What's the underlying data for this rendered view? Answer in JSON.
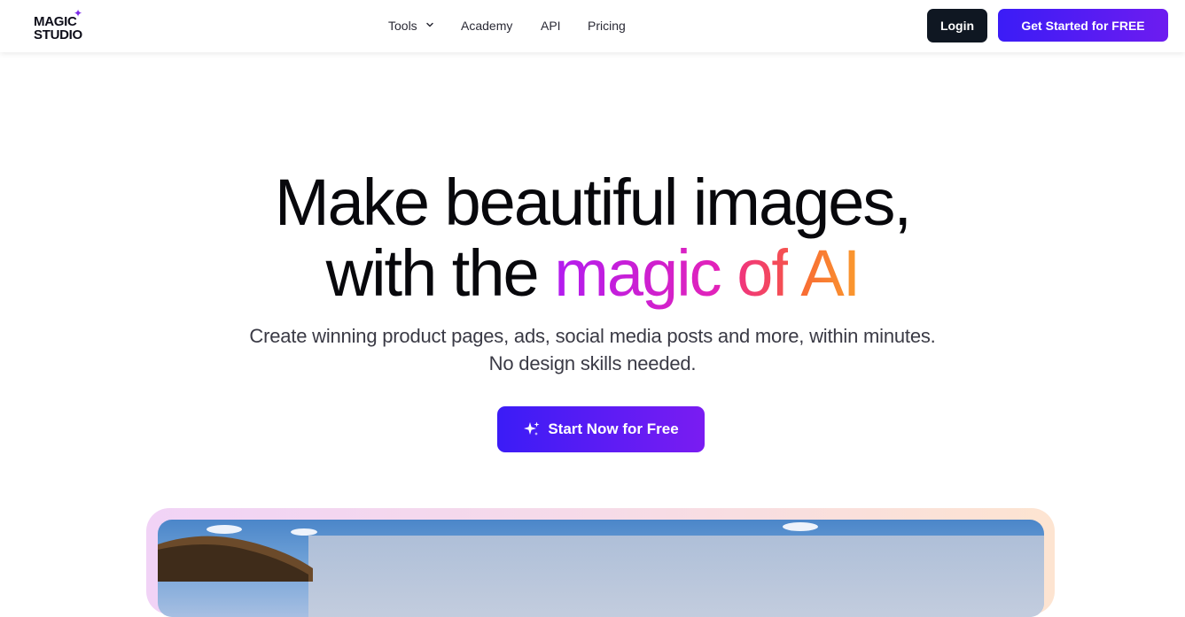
{
  "header": {
    "logo_line1": "MAGIC",
    "logo_line2": "STUDIO",
    "nav": [
      {
        "label": "Tools",
        "has_dropdown": true,
        "icon": "chevron-down-icon"
      },
      {
        "label": "Academy"
      },
      {
        "label": "API"
      },
      {
        "label": "Pricing"
      }
    ],
    "login_label": "Login",
    "get_started_label": "Get Started for FREE"
  },
  "hero": {
    "title_line1": "Make beautiful images,",
    "title_line2_prefix": "with the ",
    "title_magic": "magic",
    "title_of": "of",
    "title_ai": "AI",
    "subtitle_line1": "Create winning product pages, ads, social media posts and more, within minutes.",
    "subtitle_line2": "No design skills needed.",
    "cta_label": "Start Now for Free",
    "cta_icon": "sparkle-icon"
  },
  "colors": {
    "primary_gradient_start": "#3b1cf6",
    "primary_gradient_end": "#7a1cf2",
    "login_bg": "#0f1722",
    "magic_gradient": [
      "#b21cf0",
      "#e323b8"
    ],
    "of_gradient": [
      "#f0337f",
      "#f5524f"
    ],
    "ai_gradient": [
      "#f86a34",
      "#fa9a2e"
    ],
    "logo_accent": "#7c2ae8"
  }
}
